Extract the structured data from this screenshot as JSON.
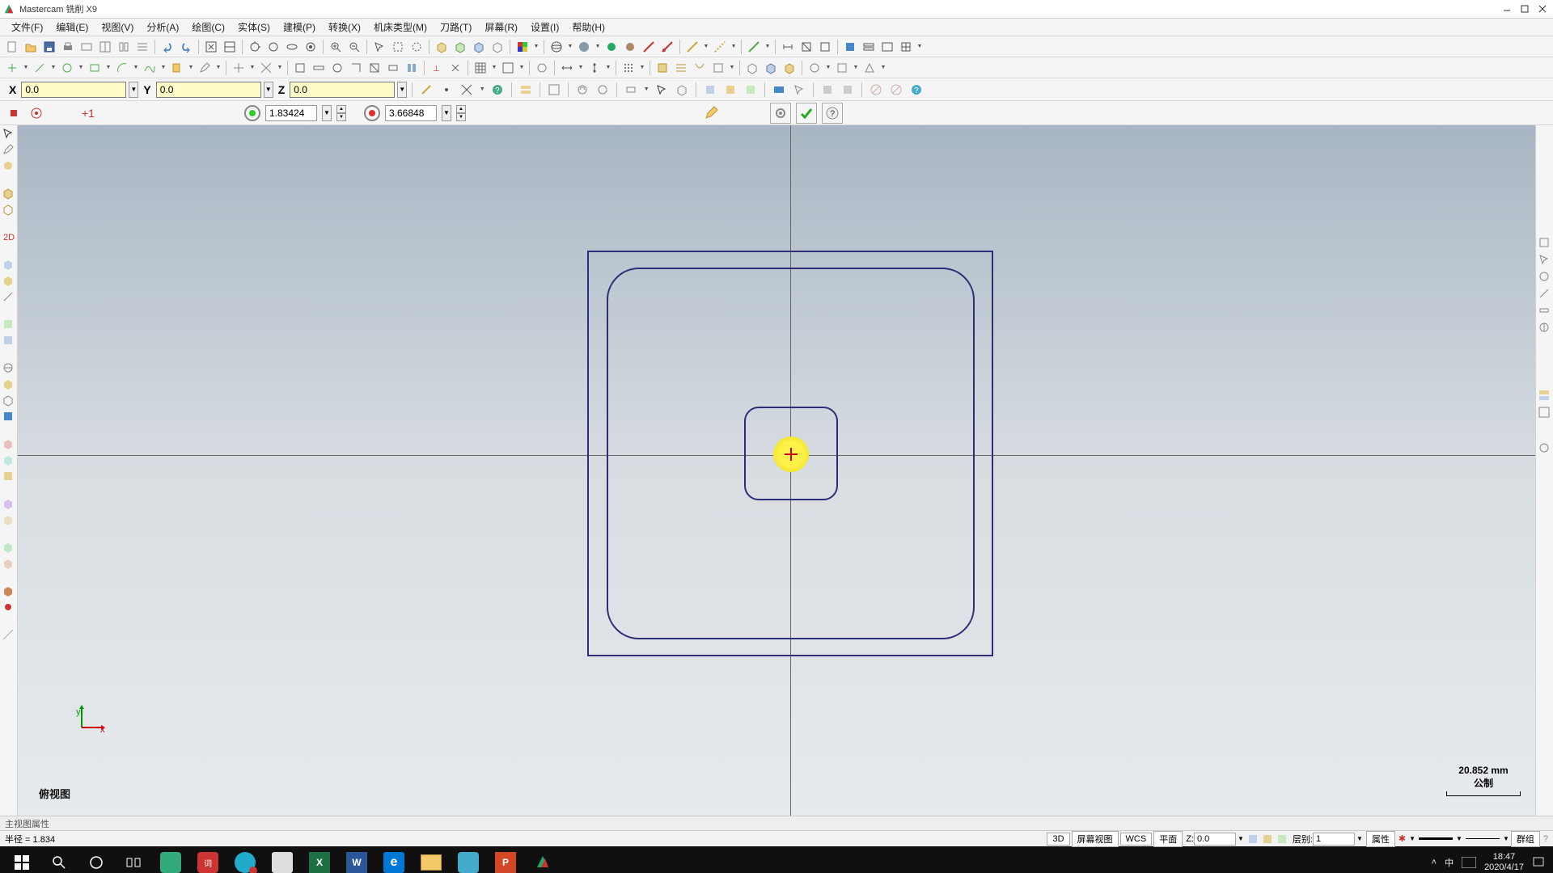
{
  "app": {
    "title": "Mastercam 铣削 X9"
  },
  "menu": [
    "文件(F)",
    "编辑(E)",
    "视图(V)",
    "分析(A)",
    "绘图(C)",
    "实体(S)",
    "建模(P)",
    "转换(X)",
    "机床类型(M)",
    "刀路(T)",
    "屏幕(R)",
    "设置(I)",
    "帮助(H)"
  ],
  "coords": {
    "xlabel": "X",
    "x": "0.0",
    "ylabel": "Y",
    "y": "0.0",
    "zlabel": "Z",
    "z": "0.0"
  },
  "params": {
    "v1": "1.83424",
    "v2": "3.66848"
  },
  "viewport": {
    "label": "俯视图",
    "scale_value": "20.852 mm",
    "scale_unit": "公制",
    "triad_x": "x",
    "triad_y": "y"
  },
  "status": {
    "mini": "主视图属性",
    "main_left": "半径 = 1.834",
    "btn3d": "3D",
    "screen": "屏幕视图",
    "wcs": "WCS",
    "plane": "平面",
    "z_lbl": "Z:",
    "z_val": "0.0",
    "layer_lbl": "层别:",
    "layer_val": "1",
    "attr": "属性",
    "group": "群组"
  },
  "tray": {
    "ime1": "中",
    "time": "18:47",
    "date": "2020/4/17"
  }
}
